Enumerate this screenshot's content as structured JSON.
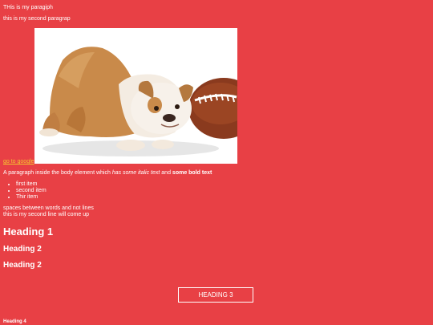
{
  "paragraphs": {
    "first": "THis is my paragiph",
    "second": "this is my second paragrap"
  },
  "image": {
    "subject": "puppy-with-football"
  },
  "link": {
    "label": "go to google"
  },
  "body_paragraph": {
    "prefix": "A paragraph inside the body element which ",
    "italic": "has some italic text",
    "middle": " and ",
    "bold": "some bold text"
  },
  "list": {
    "items": [
      "first item",
      "second item",
      "Thir item"
    ]
  },
  "preformatted": {
    "line1": "spaces between words and not lines",
    "line2": "this is my second line will come up"
  },
  "headings": {
    "h1": "Heading 1",
    "h2_first": "Heading 2",
    "h2_second": "Heading 2",
    "h3": "HEADING 3",
    "h4": "Heading 4"
  },
  "colors": {
    "background": "#e84045",
    "text": "#ffffff",
    "link": "#f4c430"
  }
}
